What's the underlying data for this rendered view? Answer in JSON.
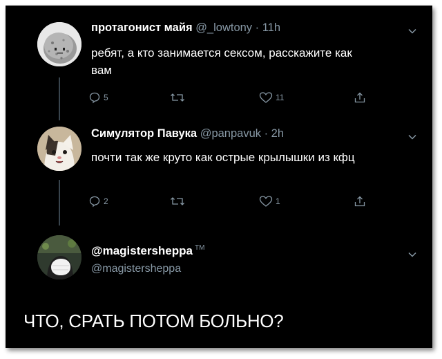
{
  "tweets": [
    {
      "name": "протагонист майя",
      "handle": "@_lowtony · 11h",
      "text": "ребят, а кто занимается сексом, расскажите как вам",
      "replies": "5",
      "retweets": "",
      "likes": "11"
    },
    {
      "name": "Симулятор Павука",
      "handle": "@panpavuk · 2h",
      "text": "почти так же круто как острые крылышки из кфц",
      "replies": "2",
      "retweets": "",
      "likes": "1"
    }
  ],
  "reply": {
    "name": "@magistersheppa",
    "tm": "TM",
    "handle": "@magistersheppa",
    "text": "ЧТО, СРАТЬ ПОТОМ БОЛЬНО?"
  },
  "icons": {
    "reply": "reply-icon",
    "retweet": "retweet-icon",
    "like": "heart-icon",
    "share": "share-icon",
    "menu": "chevron-down-icon"
  },
  "colors": {
    "background": "#000000",
    "text": "#ffffff",
    "secondary": "#8899a6",
    "thread_line": "#38444d"
  }
}
